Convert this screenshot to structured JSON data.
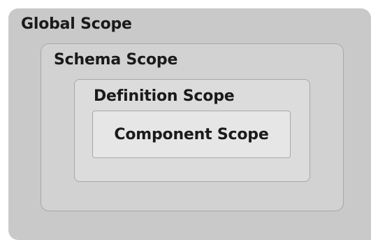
{
  "diagram": {
    "scopes": {
      "global": "Global Scope",
      "schema": "Schema Scope",
      "definition": "Definition Scope",
      "component": "Component Scope"
    }
  }
}
